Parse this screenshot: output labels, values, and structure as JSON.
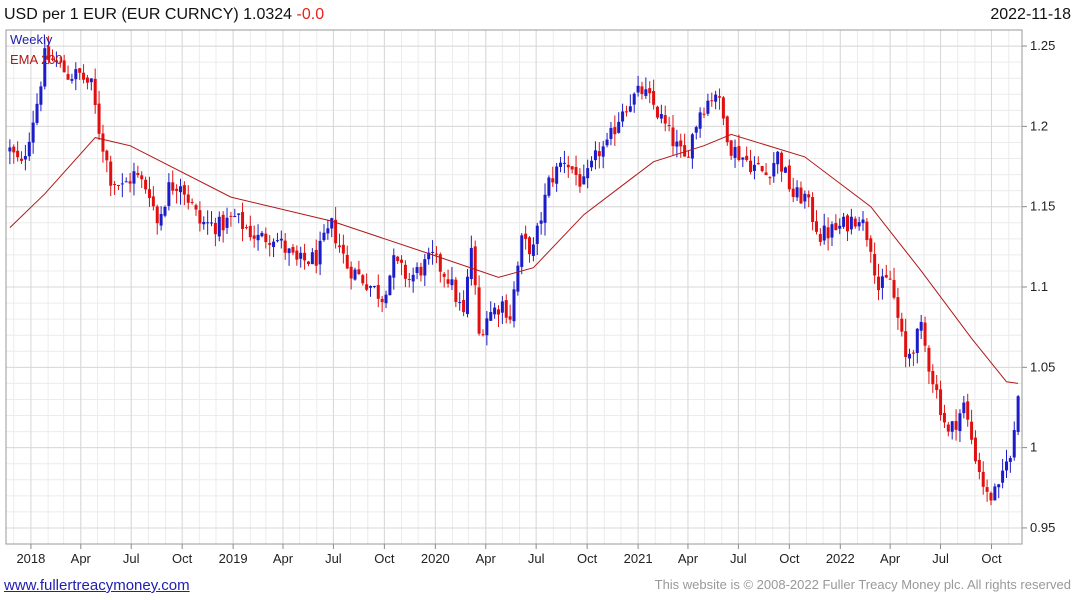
{
  "header": {
    "title": "USD per 1 EUR (EUR CURNCY) 1.0324",
    "change": "-0.0",
    "date": "2022-11-18"
  },
  "footer": {
    "link": "www.fullertreacymoney.com",
    "copyright": "This website is © 2008-2022 Fuller Treacy Money plc. All rights reserved"
  },
  "colors": {
    "up": "#1c1cc8",
    "down": "#e01010",
    "ema": "#b01818",
    "grid": "#d8d8d8",
    "frame": "#999999"
  },
  "chart_data": {
    "type": "candlestick",
    "frequency_label": "Weekly",
    "legend": [
      {
        "name": "Weekly",
        "color": "#2020b0"
      },
      {
        "name": "EMA 200",
        "color": "#b01818"
      }
    ],
    "legend_placement": "top-left",
    "ylim": [
      0.94,
      1.26
    ],
    "y_ticks": [
      "0.95",
      "1",
      "1.05",
      "1.1",
      "1.15",
      "1.2",
      "1.25"
    ],
    "y_tick_values": [
      0.95,
      1.0,
      1.05,
      1.1,
      1.15,
      1.2,
      1.25
    ],
    "x_range": [
      "2017-11-24",
      "2022-11-18"
    ],
    "x_ticks": [
      {
        "label": "2018",
        "date": "2018-01-01"
      },
      {
        "label": "Apr",
        "date": "2018-04-01"
      },
      {
        "label": "Jul",
        "date": "2018-07-01"
      },
      {
        "label": "Oct",
        "date": "2018-10-01"
      },
      {
        "label": "2019",
        "date": "2019-01-01"
      },
      {
        "label": "Apr",
        "date": "2019-04-01"
      },
      {
        "label": "Jul",
        "date": "2019-07-01"
      },
      {
        "label": "Oct",
        "date": "2019-10-01"
      },
      {
        "label": "2020",
        "date": "2020-01-01"
      },
      {
        "label": "Apr",
        "date": "2020-04-01"
      },
      {
        "label": "Jul",
        "date": "2020-07-01"
      },
      {
        "label": "Oct",
        "date": "2020-10-01"
      },
      {
        "label": "2021",
        "date": "2021-01-01"
      },
      {
        "label": "Apr",
        "date": "2021-04-01"
      },
      {
        "label": "Jul",
        "date": "2021-07-01"
      },
      {
        "label": "Oct",
        "date": "2021-10-01"
      },
      {
        "label": "2022",
        "date": "2022-01-01"
      },
      {
        "label": "Apr",
        "date": "2022-04-01"
      },
      {
        "label": "Jul",
        "date": "2022-07-01"
      },
      {
        "label": "Oct",
        "date": "2022-10-01"
      }
    ],
    "price_path": [
      [
        "2017-11-24",
        1.185
      ],
      [
        "2017-12-15",
        1.175
      ],
      [
        "2018-01-12",
        1.215
      ],
      [
        "2018-01-26",
        1.243
      ],
      [
        "2018-02-16",
        1.24
      ],
      [
        "2018-03-09",
        1.232
      ],
      [
        "2018-03-30",
        1.232
      ],
      [
        "2018-04-20",
        1.225
      ],
      [
        "2018-05-04",
        1.198
      ],
      [
        "2018-05-25",
        1.168
      ],
      [
        "2018-06-15",
        1.162
      ],
      [
        "2018-07-06",
        1.17
      ],
      [
        "2018-08-03",
        1.16
      ],
      [
        "2018-08-17",
        1.14
      ],
      [
        "2018-09-07",
        1.162
      ],
      [
        "2018-09-28",
        1.166
      ],
      [
        "2018-10-12",
        1.155
      ],
      [
        "2018-11-02",
        1.14
      ],
      [
        "2018-12-07",
        1.138
      ],
      [
        "2019-01-04",
        1.143
      ],
      [
        "2019-02-15",
        1.13
      ],
      [
        "2019-03-15",
        1.132
      ],
      [
        "2019-04-26",
        1.115
      ],
      [
        "2019-05-31",
        1.118
      ],
      [
        "2019-06-28",
        1.138
      ],
      [
        "2019-07-26",
        1.113
      ],
      [
        "2019-08-30",
        1.103
      ],
      [
        "2019-09-27",
        1.094
      ],
      [
        "2019-10-18",
        1.115
      ],
      [
        "2019-11-15",
        1.105
      ],
      [
        "2019-12-27",
        1.118
      ],
      [
        "2020-01-24",
        1.106
      ],
      [
        "2020-02-21",
        1.082
      ],
      [
        "2020-03-06",
        1.125
      ],
      [
        "2020-03-20",
        1.07
      ],
      [
        "2020-04-03",
        1.082
      ],
      [
        "2020-05-01",
        1.09
      ],
      [
        "2020-05-15",
        1.082
      ],
      [
        "2020-06-05",
        1.128
      ],
      [
        "2020-06-26",
        1.123
      ],
      [
        "2020-07-24",
        1.165
      ],
      [
        "2020-08-21",
        1.18
      ],
      [
        "2020-09-25",
        1.163
      ],
      [
        "2020-10-23",
        1.185
      ],
      [
        "2020-11-06",
        1.187
      ],
      [
        "2020-12-04",
        1.212
      ],
      [
        "2021-01-08",
        1.222
      ],
      [
        "2021-01-29",
        1.213
      ],
      [
        "2021-03-05",
        1.191
      ],
      [
        "2021-03-26",
        1.179
      ],
      [
        "2021-04-23",
        1.21
      ],
      [
        "2021-05-21",
        1.222
      ],
      [
        "2021-06-18",
        1.187
      ],
      [
        "2021-07-23",
        1.177
      ],
      [
        "2021-08-20",
        1.17
      ],
      [
        "2021-09-10",
        1.182
      ],
      [
        "2021-10-08",
        1.157
      ],
      [
        "2021-10-29",
        1.156
      ],
      [
        "2021-11-26",
        1.132
      ],
      [
        "2021-12-31",
        1.137
      ],
      [
        "2022-02-04",
        1.145
      ],
      [
        "2022-02-25",
        1.127
      ],
      [
        "2022-03-11",
        1.099
      ],
      [
        "2022-04-01",
        1.105
      ],
      [
        "2022-04-29",
        1.055
      ],
      [
        "2022-05-27",
        1.073
      ],
      [
        "2022-06-10",
        1.052
      ],
      [
        "2022-07-15",
        1.008
      ],
      [
        "2022-08-12",
        1.026
      ],
      [
        "2022-09-02",
        0.995
      ],
      [
        "2022-09-23",
        0.969
      ],
      [
        "2022-10-14",
        0.972
      ],
      [
        "2022-10-28",
        0.996
      ],
      [
        "2022-11-04",
        0.991
      ],
      [
        "2022-11-18",
        1.032
      ]
    ],
    "ema_200": [
      [
        "2017-11-24",
        1.137
      ],
      [
        "2018-01-26",
        1.158
      ],
      [
        "2018-04-27",
        1.193
      ],
      [
        "2018-06-29",
        1.188
      ],
      [
        "2018-12-28",
        1.156
      ],
      [
        "2019-06-28",
        1.141
      ],
      [
        "2019-12-27",
        1.12
      ],
      [
        "2020-04-24",
        1.106
      ],
      [
        "2020-06-26",
        1.112
      ],
      [
        "2020-09-25",
        1.145
      ],
      [
        "2021-01-29",
        1.178
      ],
      [
        "2021-04-30",
        1.188
      ],
      [
        "2021-06-18",
        1.195
      ],
      [
        "2021-10-29",
        1.181
      ],
      [
        "2022-02-25",
        1.15
      ],
      [
        "2022-05-27",
        1.11
      ],
      [
        "2022-08-26",
        1.068
      ],
      [
        "2022-10-28",
        1.041
      ],
      [
        "2022-11-18",
        1.04
      ]
    ]
  }
}
